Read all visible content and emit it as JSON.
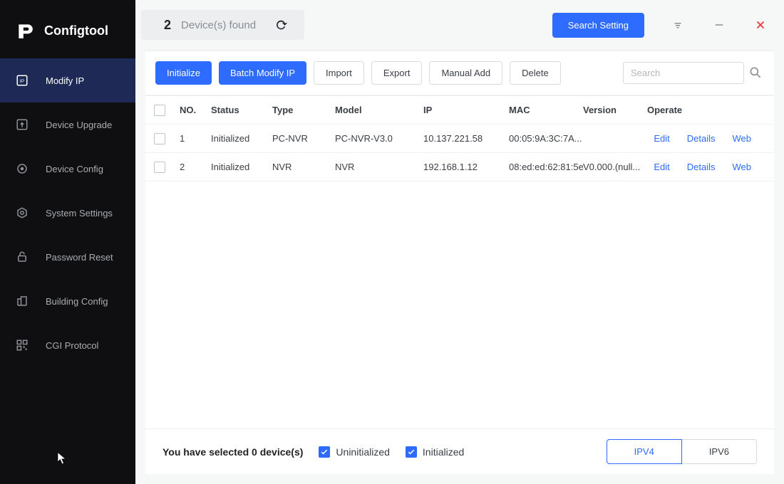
{
  "brand": {
    "title": "Configtool"
  },
  "sidebar": {
    "items": [
      {
        "label": "Modify IP",
        "icon": "ip-square-icon",
        "active": true
      },
      {
        "label": "Device Upgrade",
        "icon": "up-arrow-icon",
        "active": false
      },
      {
        "label": "Device Config",
        "icon": "target-icon",
        "active": false
      },
      {
        "label": "System Settings",
        "icon": "gear-hex-icon",
        "active": false
      },
      {
        "label": "Password Reset",
        "icon": "lock-icon",
        "active": false
      },
      {
        "label": "Building Config",
        "icon": "building-icon",
        "active": false
      },
      {
        "label": "CGI Protocol",
        "icon": "qr-icon",
        "active": false
      }
    ]
  },
  "topbar": {
    "count": "2",
    "count_label": "Device(s) found",
    "search_setting_label": "Search Setting"
  },
  "toolbar": {
    "initialize": "Initialize",
    "batch_modify_ip": "Batch Modify IP",
    "import": "Import",
    "export": "Export",
    "manual_add": "Manual Add",
    "delete": "Delete",
    "search_placeholder": "Search"
  },
  "table": {
    "headers": {
      "no": "NO.",
      "status": "Status",
      "type": "Type",
      "model": "Model",
      "ip": "IP",
      "mac": "MAC",
      "version": "Version",
      "operate": "Operate"
    },
    "op": {
      "edit": "Edit",
      "details": "Details",
      "web": "Web"
    },
    "rows": [
      {
        "no": "1",
        "status": "Initialized",
        "type": "PC-NVR",
        "model": "PC-NVR-V3.0",
        "ip": "10.137.221.58",
        "mac": "00:05:9A:3C:7A...",
        "version": ""
      },
      {
        "no": "2",
        "status": "Initialized",
        "type": "NVR",
        "model": "NVR",
        "ip": "192.168.1.12",
        "mac": "08:ed:ed:62:81:5e",
        "version": "V0.000.(null..."
      }
    ]
  },
  "footer": {
    "selected_prefix": "You have selected",
    "selected_count": "0",
    "selected_suffix": "device(s)",
    "uninitialized_label": "Uninitialized",
    "initialized_label": "Initialized",
    "ipv4": "IPV4",
    "ipv6": "IPV6"
  }
}
